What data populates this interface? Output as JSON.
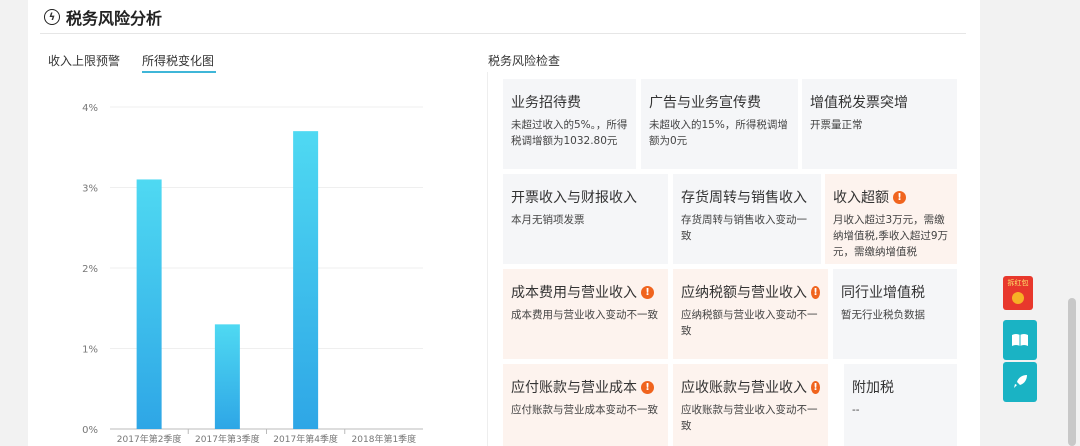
{
  "header": {
    "title": "税务风险分析",
    "icon": "bolt-icon"
  },
  "tabs": [
    {
      "label": "收入上限预警",
      "active": false
    },
    {
      "label": "所得税变化图",
      "active": true
    }
  ],
  "risk_section_title": "税务风险检查",
  "cards": [
    {
      "title": "业务招待费",
      "desc": "未超过收入的5%。，所得税调增额为1032.80元",
      "warn": false
    },
    {
      "title": "广告与业务宣传费",
      "desc": "未超收入的15%，所得税调增额为0元",
      "warn": false
    },
    {
      "title": "增值税发票突增",
      "desc": "开票量正常",
      "warn": false
    },
    {
      "title": "开票收入与财报收入",
      "desc": "本月无销项发票",
      "warn": false
    },
    {
      "title": "存货周转与销售收入",
      "desc": "存货周转与销售收入变动一致",
      "warn": false
    },
    {
      "title": "收入超额",
      "desc": "月收入超过3万元，需缴纳增值税,季收入超过9万元，需缴纳增值税",
      "warn": true
    },
    {
      "title": "成本费用与营业收入",
      "desc": "成本费用与营业收入变动不一致",
      "warn": true
    },
    {
      "title": "应纳税额与营业收入",
      "desc": "应纳税额与营业收入变动不一致",
      "warn": true
    },
    {
      "title": "同行业增值税",
      "desc": "暂无行业税负数据",
      "warn": false
    },
    {
      "title": "应付账款与营业成本",
      "desc": "应付账款与营业成本变动不一致",
      "warn": true
    },
    {
      "title": "应收账款与营业收入",
      "desc": "应收账款与营业收入变动不一致",
      "warn": true
    },
    {
      "title": "附加税",
      "desc": "--",
      "warn": false
    }
  ],
  "side": {
    "redpacket_label": "拆红包",
    "buttons": [
      {
        "icon": "book-icon"
      },
      {
        "icon": "rocket-icon"
      }
    ]
  },
  "colors": {
    "accent": "#1ab3c4",
    "bar_top": "#4fd9f2",
    "bar_bottom": "#2ea6e6",
    "warn": "#f0641e"
  },
  "chart_data": {
    "type": "bar",
    "categories": [
      "2017年第2季度",
      "2017年第3季度",
      "2017年第4季度",
      "2018年第1季度"
    ],
    "values": [
      3.1,
      1.3,
      3.7,
      0
    ],
    "ylim": [
      0,
      4
    ],
    "yticks": [
      "0%",
      "1%",
      "2%",
      "3%",
      "4%"
    ],
    "grid": true,
    "title": "",
    "xlabel": "",
    "ylabel": ""
  }
}
